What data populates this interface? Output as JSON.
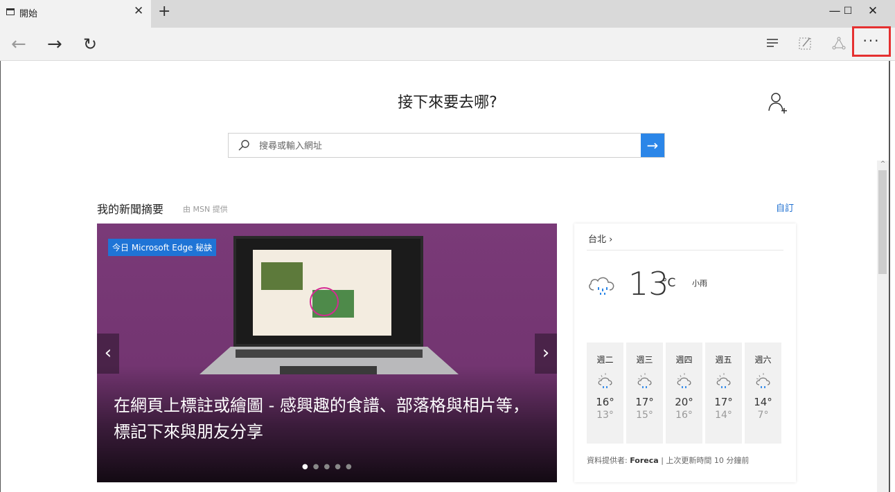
{
  "tab": {
    "title": "開始"
  },
  "window": {
    "minimize": "—",
    "maximize": "☐",
    "close": "✕"
  },
  "search": {
    "placeholder": "搜尋或輸入網址"
  },
  "page": {
    "heading": "接下來要去哪?"
  },
  "news": {
    "title": "我的新聞摘要",
    "source": "由 MSN 提供",
    "customize": "自訂",
    "badge": "今日 Microsoft Edge 秘訣",
    "headline": "在網頁上標註或繪圖 - 感興趣的食譜、部落格與相片等，標記下來與朋友分享",
    "slide_count": 5,
    "active_slide": 1
  },
  "weather": {
    "city": "台北",
    "temp": "13",
    "unit": "°C",
    "desc": "小雨",
    "forecast": [
      {
        "day": "週二",
        "high": "16°",
        "low": "13°"
      },
      {
        "day": "週三",
        "high": "17°",
        "low": "15°"
      },
      {
        "day": "週四",
        "high": "20°",
        "low": "16°"
      },
      {
        "day": "週五",
        "high": "17°",
        "low": "14°"
      },
      {
        "day": "週六",
        "high": "14°",
        "low": "7°"
      }
    ],
    "source_label": "資料提供者:",
    "source_name": "Foreca",
    "updated": "| 上次更新時間 10 分鐘前"
  },
  "icons": {
    "back": "arrow-left-icon",
    "forward": "arrow-right-icon",
    "refresh": "refresh-icon",
    "hub": "hub-icon",
    "note": "web-note-icon",
    "share": "share-icon",
    "more": "more-icon",
    "search": "search-icon",
    "go": "arrow-right-icon",
    "add_user": "add-user-icon",
    "weather": "rain-cloud-icon",
    "forecast": "partly-sunny-rain-icon"
  },
  "colors": {
    "accent": "#2b86e8",
    "highlight": "#e53030",
    "hero": "#733571"
  }
}
